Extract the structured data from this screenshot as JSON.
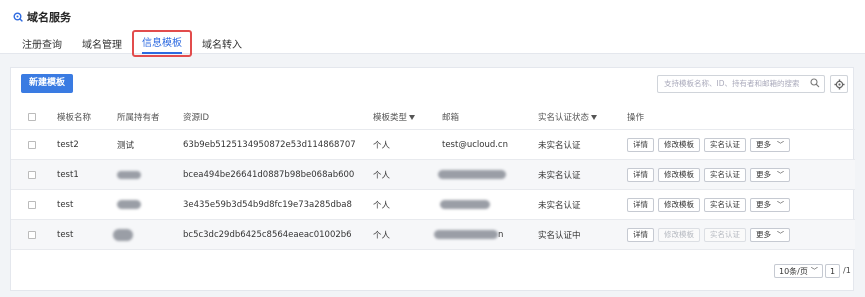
{
  "header": {
    "service_title": "域名服务"
  },
  "tabs": [
    {
      "label": "注册查询",
      "active": false
    },
    {
      "label": "域名管理",
      "active": false
    },
    {
      "label": "信息模板",
      "active": true
    },
    {
      "label": "域名转入",
      "active": false
    }
  ],
  "toolbar": {
    "new_button": "新建模板",
    "search_placeholder": "支持模板名称、ID、持有者和邮箱的搜索"
  },
  "table": {
    "columns": [
      "模板名称",
      "所属持有者",
      "资源ID",
      "模板类型",
      "邮箱",
      "实名认证状态",
      "操作"
    ],
    "rows": [
      {
        "name": "test2",
        "owner": "测试",
        "owner_redacted": false,
        "resource_id": "63b9eb5125134950872e53d114868707",
        "type": "个人",
        "email": "test@ucloud.cn",
        "email_redacted": false,
        "email_suffix": "",
        "status": "未实名认证",
        "edit_disabled": false,
        "verify_disabled": false
      },
      {
        "name": "test1",
        "owner": "",
        "owner_redacted": true,
        "resource_id": "bcea494be26641d0887b98be068ab600",
        "type": "个人",
        "email": "",
        "email_redacted": true,
        "email_suffix": "",
        "status": "未实名认证",
        "edit_disabled": false,
        "verify_disabled": false
      },
      {
        "name": "test",
        "owner": "",
        "owner_redacted": true,
        "resource_id": "3e435e59b3d54b9d8fc19e73a285dba8",
        "type": "个人",
        "email": "",
        "email_redacted": true,
        "email_suffix": "",
        "status": "未实名认证",
        "edit_disabled": false,
        "verify_disabled": false
      },
      {
        "name": "test",
        "owner": "",
        "owner_redacted": true,
        "resource_id": "bc5c3dc29db6425c8564eaeac01002b6",
        "type": "个人",
        "email": "",
        "email_redacted": true,
        "email_suffix": "n",
        "status": "实名认证中",
        "edit_disabled": true,
        "verify_disabled": true
      }
    ],
    "actions": {
      "detail": "详情",
      "edit": "修改模板",
      "verify": "实名认证",
      "more": "更多"
    }
  },
  "pagination": {
    "page_size": "10条/页",
    "current_page": "1",
    "total_pages": "/1"
  },
  "colors": {
    "accent": "#3a7be2",
    "highlight_border": "#e24c4c"
  }
}
